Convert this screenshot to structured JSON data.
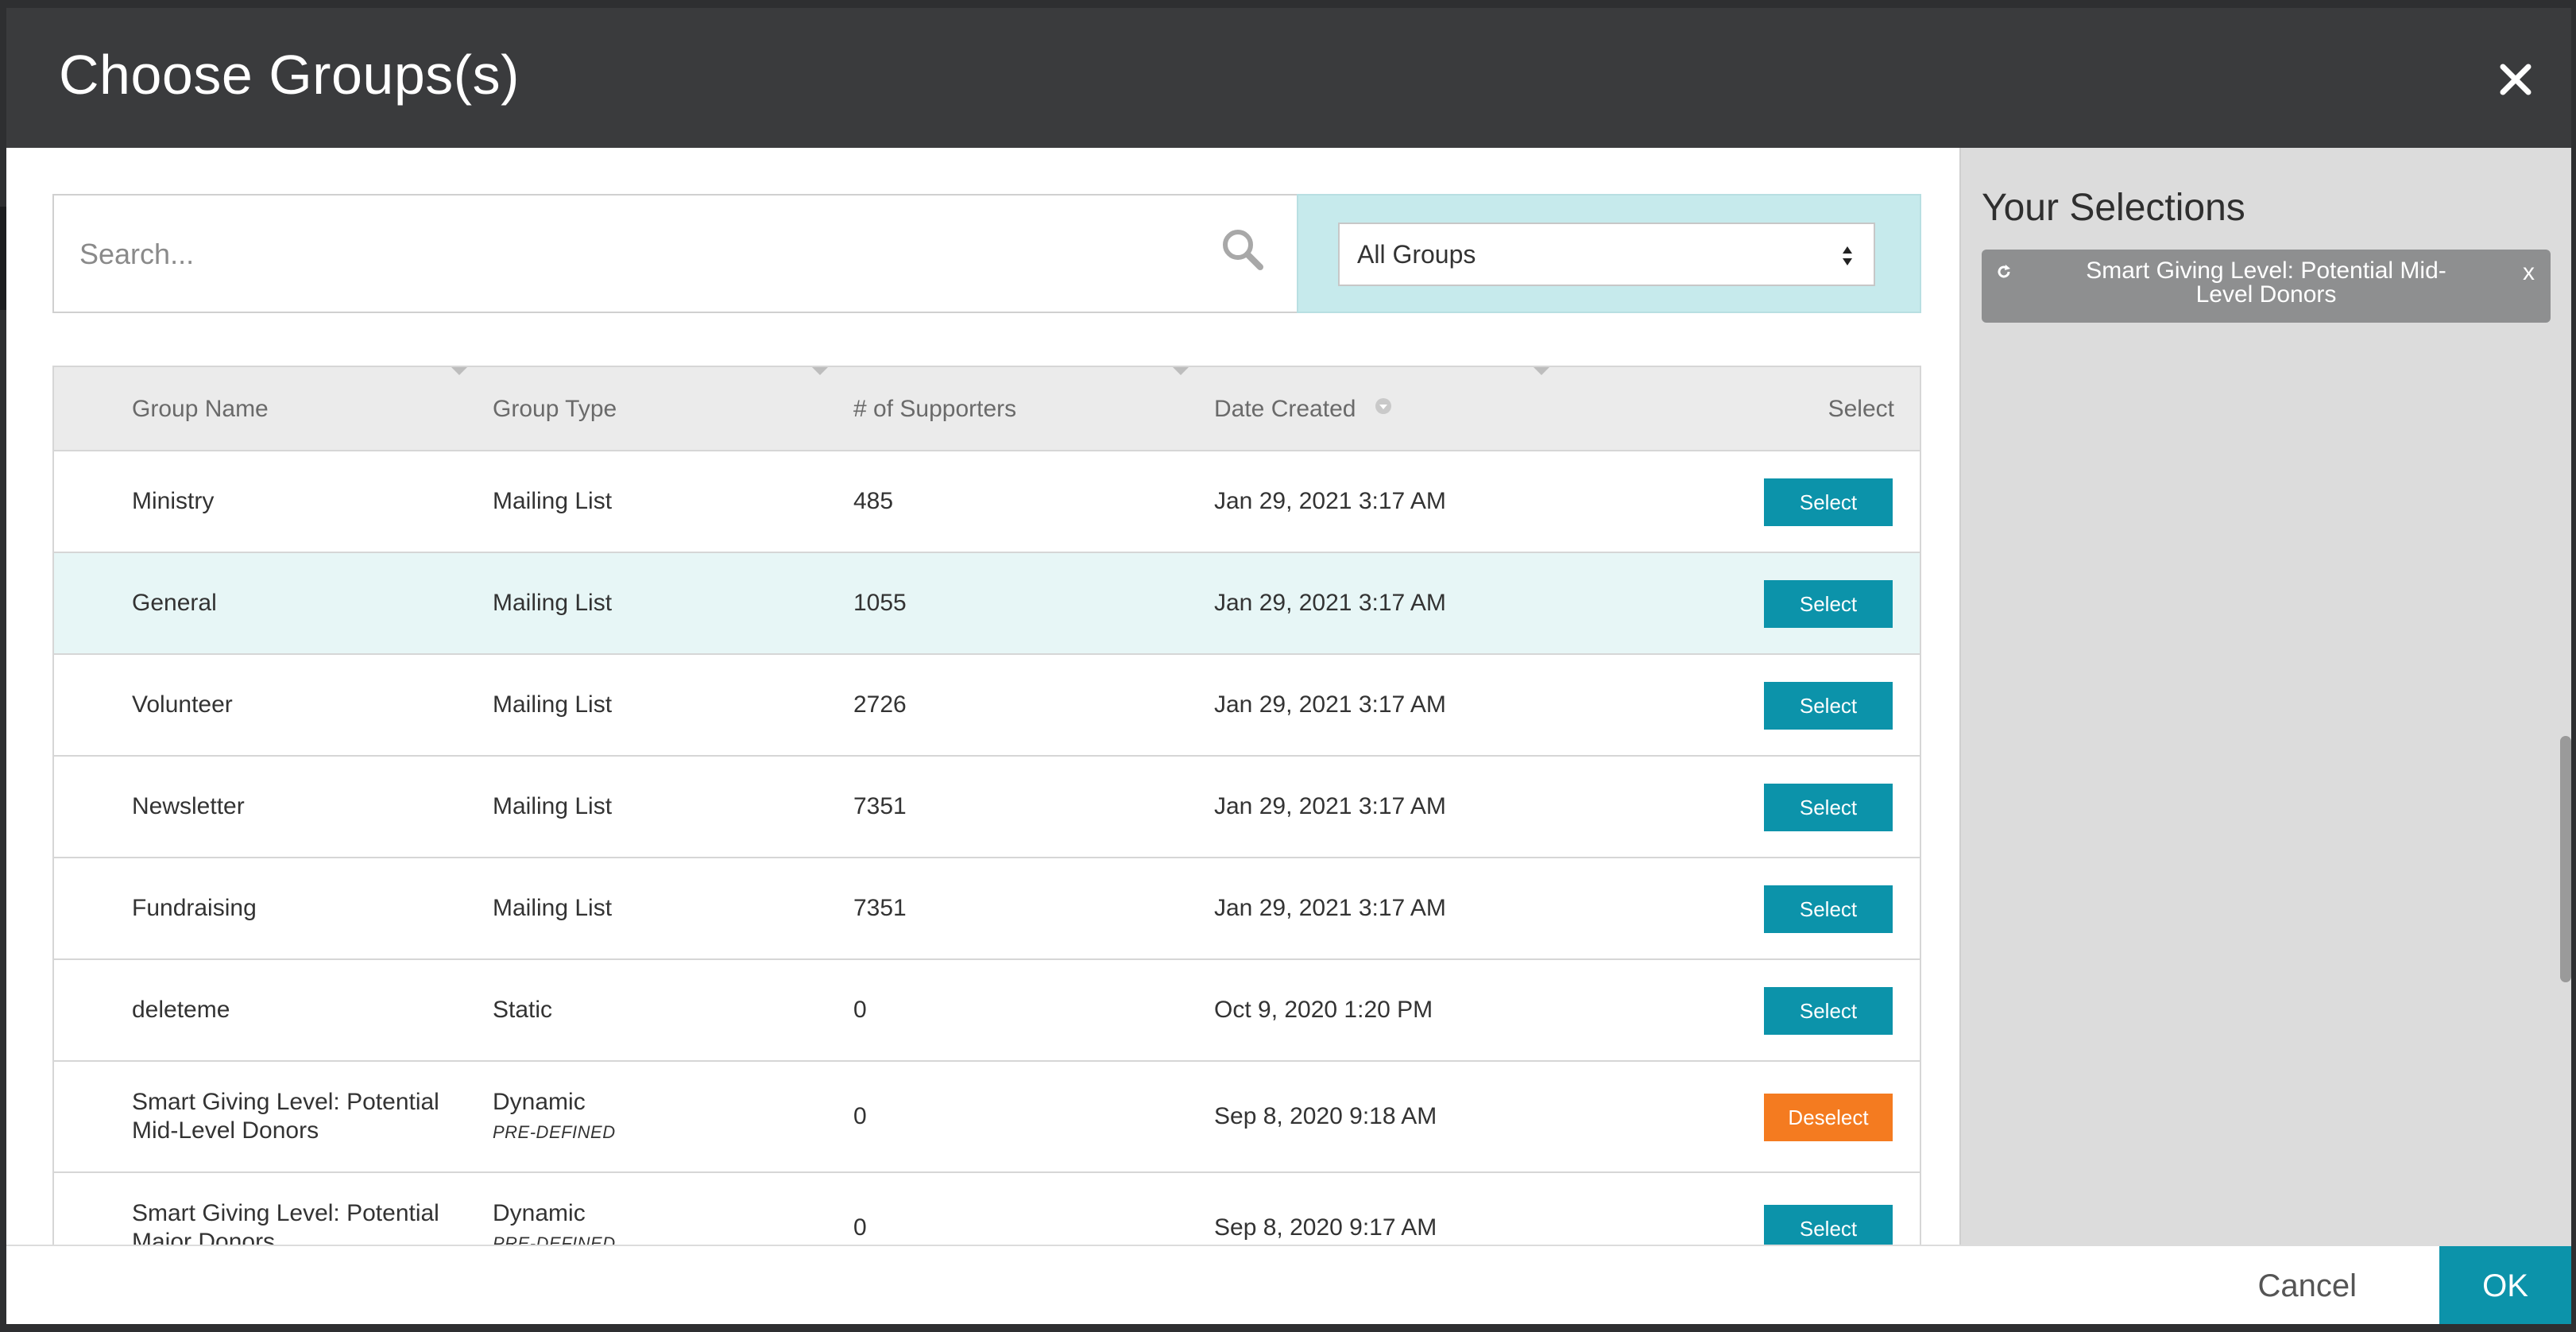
{
  "dialog": {
    "title": "Choose Groups(s)",
    "close_icon": "close-icon"
  },
  "search": {
    "placeholder": "Search...",
    "icon": "search-icon"
  },
  "filter": {
    "selected": "All Groups"
  },
  "table": {
    "headers": {
      "group_name": "Group Name",
      "group_type": "Group Type",
      "supporters": "# of Supporters",
      "date_created": "Date Created",
      "select": "Select"
    },
    "rows": [
      {
        "name": "Ministry",
        "type": "Mailing List",
        "subtype": "",
        "supporters": "485",
        "date": "Jan 29, 2021 3:17 AM",
        "action": "Select"
      },
      {
        "name": "General",
        "type": "Mailing List",
        "subtype": "",
        "supporters": "1055",
        "date": "Jan 29, 2021 3:17 AM",
        "action": "Select"
      },
      {
        "name": "Volunteer",
        "type": "Mailing List",
        "subtype": "",
        "supporters": "2726",
        "date": "Jan 29, 2021 3:17 AM",
        "action": "Select"
      },
      {
        "name": "Newsletter",
        "type": "Mailing List",
        "subtype": "",
        "supporters": "7351",
        "date": "Jan 29, 2021 3:17 AM",
        "action": "Select"
      },
      {
        "name": "Fundraising",
        "type": "Mailing List",
        "subtype": "",
        "supporters": "7351",
        "date": "Jan 29, 2021 3:17 AM",
        "action": "Select"
      },
      {
        "name": "deleteme",
        "type": "Static",
        "subtype": "",
        "supporters": "0",
        "date": "Oct 9, 2020 1:20 PM",
        "action": "Select"
      },
      {
        "name_line1": "Smart Giving Level: Potential",
        "name_line2": "Mid-Level Donors",
        "type": "Dynamic",
        "subtype": "PRE-DEFINED",
        "supporters": "0",
        "date": "Sep 8, 2020 9:18 AM",
        "action": "Deselect"
      },
      {
        "name_line1": "Smart Giving Level: Potential",
        "name_line2": "Major Donors",
        "type": "Dynamic",
        "subtype": "PRE-DEFINED",
        "supporters": "0",
        "date": "Sep 8, 2020 9:17 AM",
        "action": "Select"
      }
    ]
  },
  "selections": {
    "title": "Your Selections",
    "chip_line1": "Smart Giving Level: Potential Mid-",
    "chip_line2": "Level Donors",
    "chip_remove": "x"
  },
  "footer": {
    "cancel": "Cancel",
    "ok": "OK"
  },
  "colors": {
    "header_bg": "#3a3b3d",
    "accent": "#0c93aa",
    "deselect": "#f47b20",
    "filter_bg": "#c6eaec",
    "highlight_row": "#e7f6f6",
    "panel_bg": "#dcdcdc"
  }
}
